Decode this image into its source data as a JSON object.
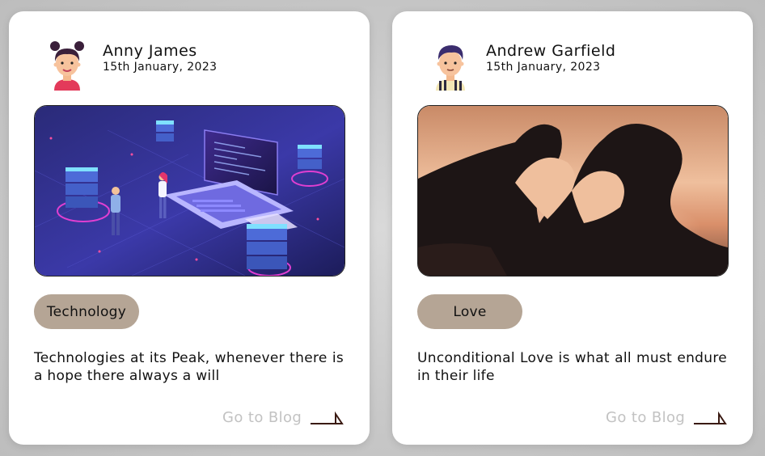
{
  "posts": [
    {
      "author": "Anny James",
      "date": "15th January, 2023",
      "tag": "Technology",
      "excerpt": "Technologies at its Peak, whenever there is a hope there always a will",
      "link_label": "Go to Blog",
      "avatar_icon": "woman-avatar-icon",
      "cover_image": "isometric-technology-illustration"
    },
    {
      "author": "Andrew Garfield",
      "date": "15th January, 2023",
      "tag": "Love",
      "excerpt": "Unconditional Love is what all must endure in their life",
      "link_label": "Go to Blog",
      "avatar_icon": "man-avatar-icon",
      "cover_image": "heart-hands-silhouette-photo"
    }
  ],
  "colors": {
    "tag_background": "#b5a595",
    "link_text": "#c2c2c2",
    "arrow": "#3a1a12"
  }
}
